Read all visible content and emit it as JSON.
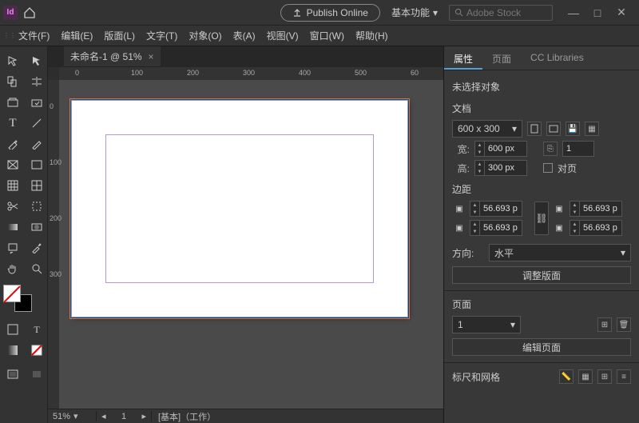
{
  "titlebar": {
    "app_badge": "Id",
    "publish_label": "Publish Online",
    "workspace_label": "基本功能",
    "search_placeholder": "Adobe Stock"
  },
  "menus": [
    "文件(F)",
    "编辑(E)",
    "版面(L)",
    "文字(T)",
    "对象(O)",
    "表(A)",
    "视图(V)",
    "窗口(W)",
    "帮助(H)"
  ],
  "doc_tab": {
    "title": "未命名-1 @ 51%",
    "close": "×"
  },
  "ruler_h": [
    "0",
    "100",
    "200",
    "300",
    "400",
    "500",
    "60"
  ],
  "ruler_v": [
    "0",
    "100",
    "200",
    "300"
  ],
  "statusbar": {
    "zoom": "51%",
    "page_nav": "1",
    "info": "[基本]（工作）"
  },
  "panel": {
    "tabs": {
      "props": "属性",
      "pages": "页面",
      "cc": "CC Libraries"
    },
    "no_selection": "未选择对象",
    "doc_section": "文档",
    "preset_value": "600 x 300",
    "width_label": "宽:",
    "width_value": "600 px",
    "height_label": "高:",
    "height_value": "300 px",
    "facing_label": "对页",
    "mirror_value": "1",
    "margins_section": "边距",
    "margin_tl": "56.693 p",
    "margin_tr": "56.693 p",
    "margin_bl": "56.693 p",
    "margin_br": "56.693 p",
    "orient_label": "方向:",
    "orient_value": "水平",
    "adjust_layout": "调整版面",
    "pages_section": "页面",
    "page_value": "1",
    "edit_pages": "编辑页面",
    "ruler_grid": "标尺和网格"
  }
}
